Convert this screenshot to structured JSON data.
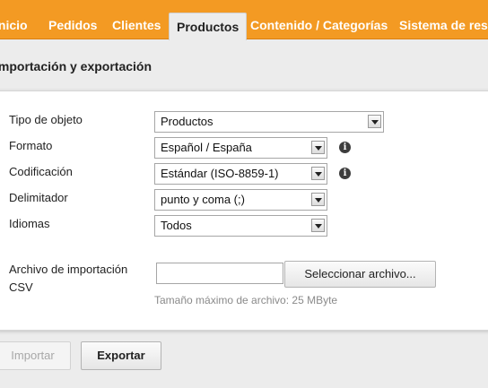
{
  "nav": {
    "tabs": [
      {
        "label": "Inicio"
      },
      {
        "label": "Pedidos"
      },
      {
        "label": "Clientes"
      },
      {
        "label": "Productos"
      },
      {
        "label": "Contenido / Categorías"
      },
      {
        "label": "Sistema de rese"
      }
    ],
    "active_tab": "Productos"
  },
  "page": {
    "title": "Importación y exportación"
  },
  "form": {
    "object_type": {
      "label": "Tipo de objeto",
      "value": "Productos"
    },
    "format": {
      "label": "Formato",
      "value": "Español / España"
    },
    "encoding": {
      "label": "Codificación",
      "value": "Estándar (ISO-8859-1)"
    },
    "delimiter": {
      "label": "Delimitador",
      "value": "punto y coma (;)"
    },
    "languages": {
      "label": "Idiomas",
      "value": "Todos"
    },
    "import_file": {
      "label_line1": "Archivo de importación",
      "label_line2": "CSV",
      "value": "",
      "button": "Seleccionar archivo...",
      "hint": "Tamaño máximo de archivo: 25 MByte"
    },
    "info_glyph": "i"
  },
  "actions": {
    "import": "Importar",
    "export": "Exportar"
  },
  "colors": {
    "nav_bg": "#f39a23",
    "page_bg": "#ececec",
    "panel_bg": "#ffffff",
    "hint": "#8a8a8a"
  }
}
